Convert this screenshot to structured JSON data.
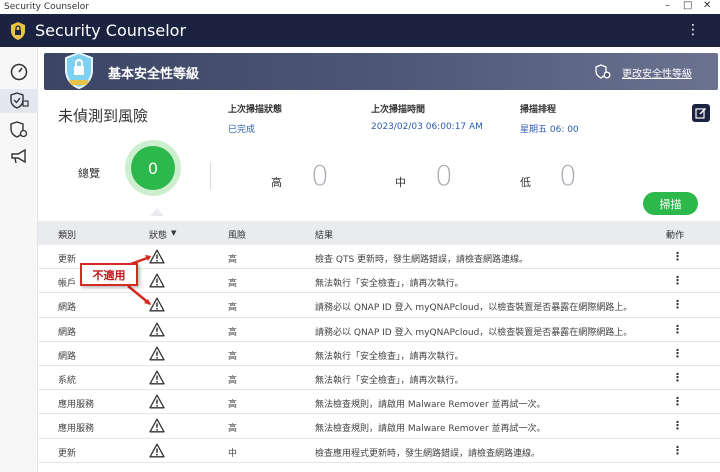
{
  "window": {
    "title": "Security Counselor"
  },
  "appbar": {
    "title": "Security Counselor"
  },
  "banner": {
    "level": "基本安全性等級",
    "change_link": "更改安全性等級"
  },
  "summary": {
    "status": "未偵測到風險",
    "overview_label": "總覽",
    "score": "0",
    "last_scan_status_label": "上次掃描狀態",
    "last_scan_status_value": "已完成",
    "last_scan_time_label": "上次掃描時間",
    "last_scan_time_value": "2023/02/03 06:00:17 AM",
    "scan_schedule_label": "掃描排程",
    "scan_schedule_value": "星期五 06: 00",
    "high_label": "高",
    "high_count": "0",
    "medium_label": "中",
    "medium_count": "0",
    "low_label": "低",
    "low_count": "0",
    "scan_button": "掃描"
  },
  "table": {
    "headers": {
      "category": "類別",
      "status": "狀態",
      "sort_indicator": "▼",
      "risk": "風險",
      "result": "結果",
      "action": "動作"
    },
    "rows": [
      {
        "category": "更新",
        "risk": "高",
        "result": "檢查 QTS 更新時，發生網路錯誤，請檢查網路連線。"
      },
      {
        "category": "帳戶",
        "risk": "高",
        "result": "無法執行「安全檢查」，請再次執行。"
      },
      {
        "category": "網路",
        "risk": "高",
        "result": "請務必以 QNAP ID 登入 myQNAPcloud，以檢查裝置是否暴露在網際網路上。"
      },
      {
        "category": "網路",
        "risk": "高",
        "result": "請務必以 QNAP ID 登入 myQNAPcloud，以檢查裝置是否暴露在網際網路上。"
      },
      {
        "category": "網路",
        "risk": "高",
        "result": "無法執行「安全檢查」，請再次執行。"
      },
      {
        "category": "系統",
        "risk": "高",
        "result": "無法執行「安全檢查」，請再次執行。"
      },
      {
        "category": "應用服務",
        "risk": "高",
        "result": "無法檢查規則，請啟用 Malware Remover 並再試一次。"
      },
      {
        "category": "應用服務",
        "risk": "高",
        "result": "無法檢查規則，請啟用 Malware Remover 並再試一次。"
      },
      {
        "category": "更新",
        "risk": "中",
        "result": "檢查應用程式更新時，發生網路錯誤，請檢查網路連線。"
      }
    ],
    "row_action_glyph": "⋮"
  },
  "callout": {
    "text": "不適用"
  },
  "window_controls": {
    "minimize": "–",
    "maximize": "□",
    "close": "✕"
  },
  "appbar_menu_glyph": "⋮",
  "colors": {
    "appbar": "#1b2340",
    "accent_green": "#2cb84a",
    "link_blue": "#2a5db0",
    "callout_red": "#d42a1f"
  }
}
